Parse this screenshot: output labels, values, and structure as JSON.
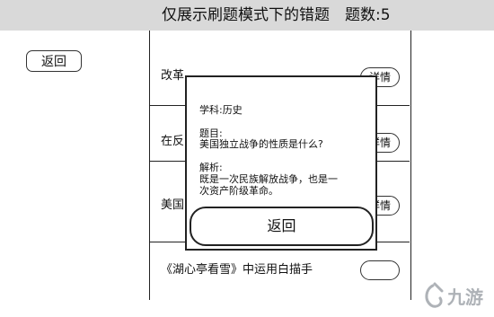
{
  "header": {
    "title": "仅展示刷题模式下的错题　题数:5"
  },
  "back_button": {
    "label": "返回"
  },
  "list": {
    "items": [
      {
        "text": "改革",
        "button": "详情"
      },
      {
        "text": "在反",
        "button": "详情"
      },
      {
        "text": "美国",
        "button": "详情"
      },
      {
        "text": "《湖心亭看雪》中运用白描手",
        "button": ""
      }
    ]
  },
  "dialog": {
    "subject": "学科:历史",
    "question_label": "题目:",
    "question": "美国独立战争的性质是什么?",
    "analysis_label": "解析:",
    "analysis_line1": "既是一次民族解放战争，也是一",
    "analysis_line2": "次资产阶级革命。",
    "return_label": "返回"
  },
  "watermark": {
    "text": "九游",
    "icon": "jiuyou-logo-icon"
  }
}
